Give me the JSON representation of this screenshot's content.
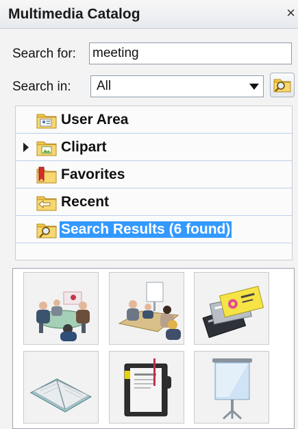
{
  "panel": {
    "title": "Multimedia Catalog",
    "close_glyph": "×"
  },
  "search": {
    "for_label": "Search for:",
    "for_value": "meeting",
    "in_label": "Search in:",
    "in_value": "All",
    "button_icon": "folder-search-icon"
  },
  "tree": {
    "items": [
      {
        "label": "User Area",
        "icon": "user-folder-icon",
        "expandable": false,
        "selected": false
      },
      {
        "label": "Clipart",
        "icon": "clipart-folder-icon",
        "expandable": true,
        "selected": false
      },
      {
        "label": "Favorites",
        "icon": "favorites-folder-icon",
        "expandable": false,
        "selected": false
      },
      {
        "label": "Recent",
        "icon": "recent-folder-icon",
        "expandable": false,
        "selected": false
      },
      {
        "label": "Search Results (6 found)",
        "icon": "search-folder-icon",
        "expandable": false,
        "selected": true
      }
    ]
  },
  "results": {
    "items": [
      {
        "icon": "meeting-table-icon"
      },
      {
        "icon": "conference-presentation-icon"
      },
      {
        "icon": "business-cards-icon"
      },
      {
        "icon": "notebook-icon"
      },
      {
        "icon": "organizer-icon"
      },
      {
        "icon": "projector-screen-icon"
      }
    ]
  },
  "colors": {
    "selection": "#3399ff",
    "row_divider": "#b9d1ea"
  }
}
